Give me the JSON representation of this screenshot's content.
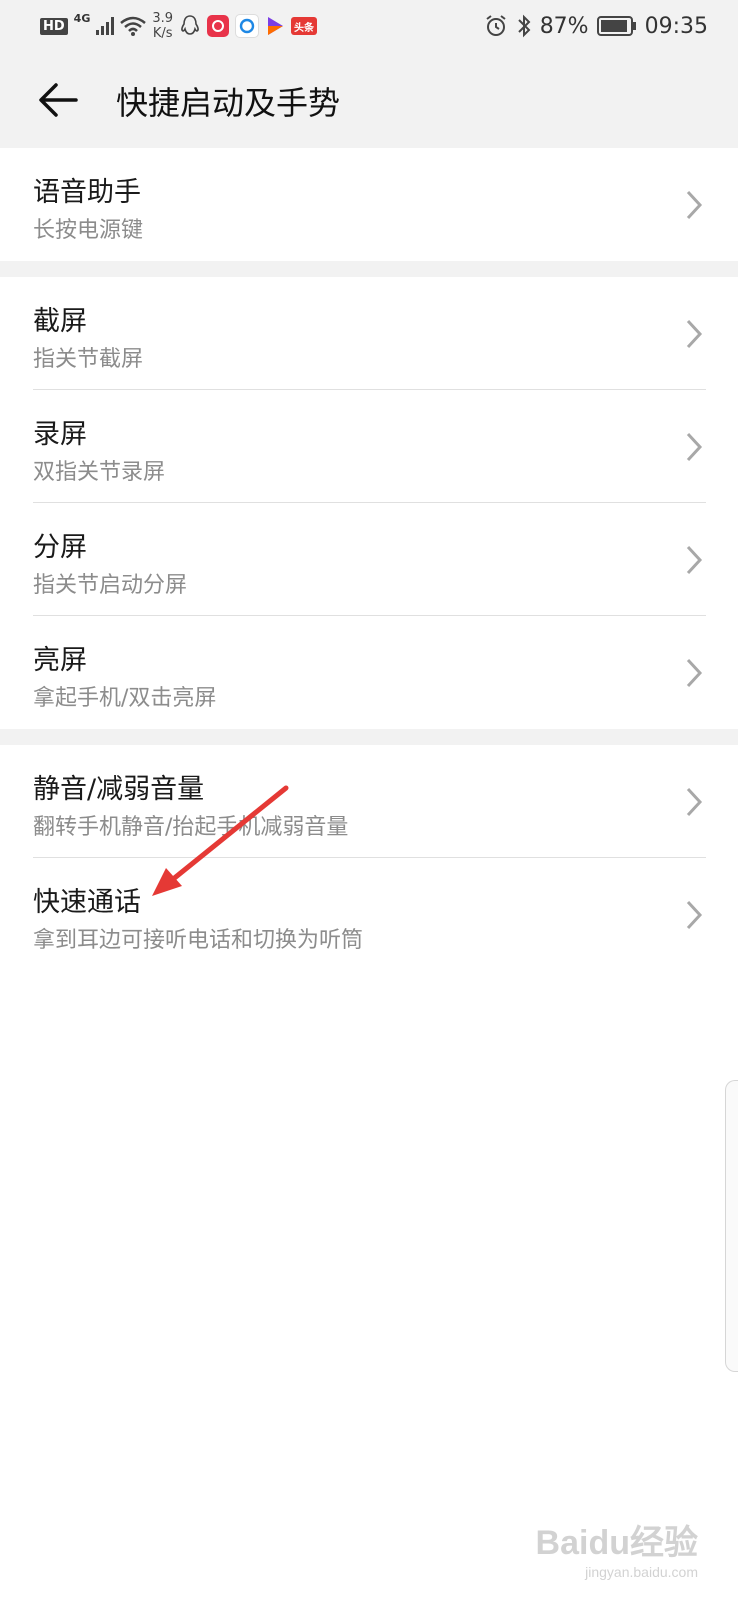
{
  "status_bar": {
    "hd": "HD",
    "net_type": "4G",
    "speed_value": "3.9",
    "speed_unit": "K/s",
    "battery": "87%",
    "time": "09:35",
    "app_icons": [
      "qq-icon",
      "app-icon",
      "browser-icon",
      "video-icon",
      "toutiao-icon"
    ],
    "toutiao_label": "头条"
  },
  "header": {
    "title": "快捷启动及手势"
  },
  "sections": [
    {
      "items": [
        {
          "title": "语音助手",
          "subtitle": "长按电源键"
        }
      ]
    },
    {
      "items": [
        {
          "title": "截屏",
          "subtitle": "指关节截屏"
        },
        {
          "title": "录屏",
          "subtitle": "双指关节录屏"
        },
        {
          "title": "分屏",
          "subtitle": "指关节启动分屏"
        },
        {
          "title": "亮屏",
          "subtitle": "拿起手机/双击亮屏"
        }
      ]
    },
    {
      "items": [
        {
          "title": "静音/减弱音量",
          "subtitle": "翻转手机静音/抬起手机减弱音量"
        },
        {
          "title": "快速通话",
          "subtitle": "拿到耳边可接听电话和切换为听筒"
        }
      ]
    }
  ],
  "watermark": {
    "brand": "Baidu经验",
    "url": "jingyan.baidu.com"
  },
  "colors": {
    "background": "#ffffff",
    "header_bg": "#f2f2f2",
    "subtitle": "#8c8c8c",
    "annotation_arrow": "#e53935"
  }
}
